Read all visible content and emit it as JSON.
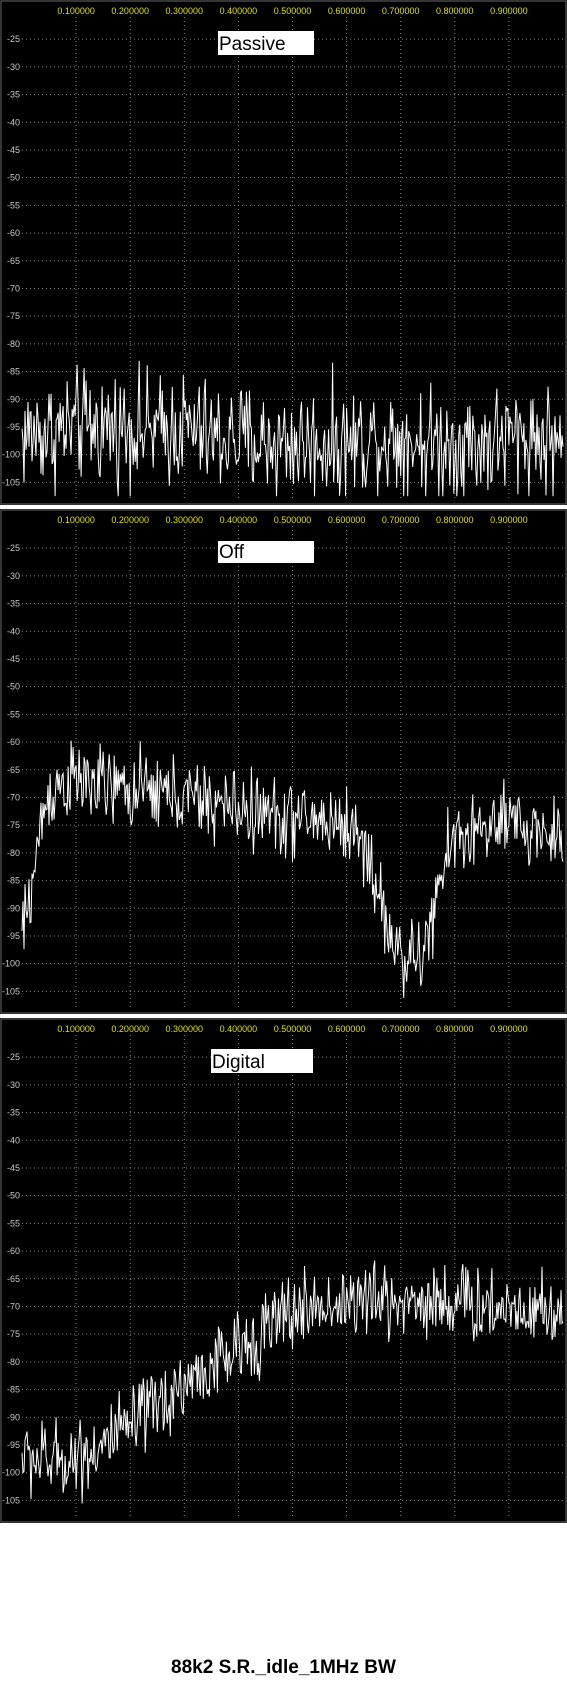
{
  "caption": "88k2 S.R._idle_1MHz BW",
  "colors": {
    "background": "#000000",
    "grid": "#8a8a8a",
    "x_tick_labels": "#e0e000",
    "y_tick_labels": "#c8c8c8",
    "trace": "#ffffff",
    "label_box": "#ffffff",
    "label_text": "#000000"
  },
  "chart_data": [
    {
      "type": "line",
      "title": "Passive",
      "xlim": [
        0.0,
        1.0
      ],
      "ylim": [
        -108,
        -21
      ],
      "x_ticks": [
        "0.100000",
        "0.200000",
        "0.300000",
        "0.400000",
        "0.500000",
        "0.600000",
        "0.700000",
        "0.800000",
        "0.900000"
      ],
      "y_ticks": [
        "-25",
        "-30",
        "-35",
        "-40",
        "-45",
        "-50",
        "-55",
        "-60",
        "-65",
        "-70",
        "-75",
        "-80",
        "-85",
        "-90",
        "-95",
        "-100",
        "-105"
      ],
      "grid": true,
      "noise_db": 5,
      "series": [
        {
          "x": [
            0.0,
            0.02,
            0.05,
            0.1,
            0.15,
            0.2,
            0.25,
            0.3,
            0.35,
            0.4,
            0.45,
            0.5,
            0.55,
            0.6,
            0.65,
            0.7,
            0.75,
            0.8,
            0.85,
            0.9,
            0.95,
            1.0
          ],
          "y": [
            -97,
            -96,
            -96,
            -95,
            -95,
            -95,
            -96,
            -95,
            -97,
            -97,
            -98,
            -98,
            -98,
            -98,
            -97,
            -97,
            -98,
            -98,
            -98,
            -97,
            -97,
            -98
          ]
        }
      ]
    },
    {
      "type": "line",
      "title": "Off",
      "xlim": [
        0.0,
        1.0
      ],
      "ylim": [
        -108,
        -21
      ],
      "x_ticks": [
        "0.100000",
        "0.200000",
        "0.300000",
        "0.400000",
        "0.500000",
        "0.600000",
        "0.700000",
        "0.800000",
        "0.900000"
      ],
      "y_ticks": [
        "-25",
        "-30",
        "-35",
        "-40",
        "-45",
        "-50",
        "-55",
        "-60",
        "-65",
        "-70",
        "-75",
        "-80",
        "-85",
        "-90",
        "-95",
        "-100",
        "-105"
      ],
      "grid": true,
      "noise_db": 3.5,
      "series": [
        {
          "x": [
            0.0,
            0.02,
            0.04,
            0.06,
            0.1,
            0.15,
            0.2,
            0.25,
            0.3,
            0.35,
            0.4,
            0.45,
            0.5,
            0.55,
            0.6,
            0.62,
            0.64,
            0.66,
            0.68,
            0.7,
            0.72,
            0.74,
            0.76,
            0.78,
            0.8,
            0.85,
            0.9,
            0.95,
            1.0
          ],
          "y": [
            -95,
            -85,
            -72,
            -68,
            -67,
            -68,
            -69,
            -69,
            -70,
            -71,
            -72,
            -73,
            -74,
            -74,
            -75,
            -77,
            -80,
            -88,
            -95,
            -98,
            -100,
            -98,
            -92,
            -82,
            -77,
            -76,
            -75,
            -76,
            -77
          ]
        }
      ]
    },
    {
      "type": "line",
      "title": "Digital",
      "xlim": [
        0.0,
        1.0
      ],
      "ylim": [
        -108,
        -21
      ],
      "x_ticks": [
        "0.100000",
        "0.200000",
        "0.300000",
        "0.400000",
        "0.500000",
        "0.600000",
        "0.700000",
        "0.800000",
        "0.900000"
      ],
      "y_ticks": [
        "-25",
        "-30",
        "-35",
        "-40",
        "-45",
        "-50",
        "-55",
        "-60",
        "-65",
        "-70",
        "-75",
        "-80",
        "-85",
        "-90",
        "-95",
        "-100",
        "-105"
      ],
      "grid": true,
      "noise_db": 3.5,
      "series": [
        {
          "x": [
            0.0,
            0.05,
            0.1,
            0.15,
            0.2,
            0.25,
            0.3,
            0.35,
            0.4,
            0.45,
            0.5,
            0.55,
            0.6,
            0.65,
            0.7,
            0.75,
            0.8,
            0.85,
            0.9,
            0.95,
            1.0
          ],
          "y": [
            -97,
            -98,
            -97,
            -95,
            -92,
            -88,
            -84,
            -81,
            -78,
            -74,
            -71,
            -70,
            -69,
            -69,
            -69,
            -69,
            -69,
            -70,
            -70,
            -70,
            -71
          ]
        }
      ]
    }
  ]
}
